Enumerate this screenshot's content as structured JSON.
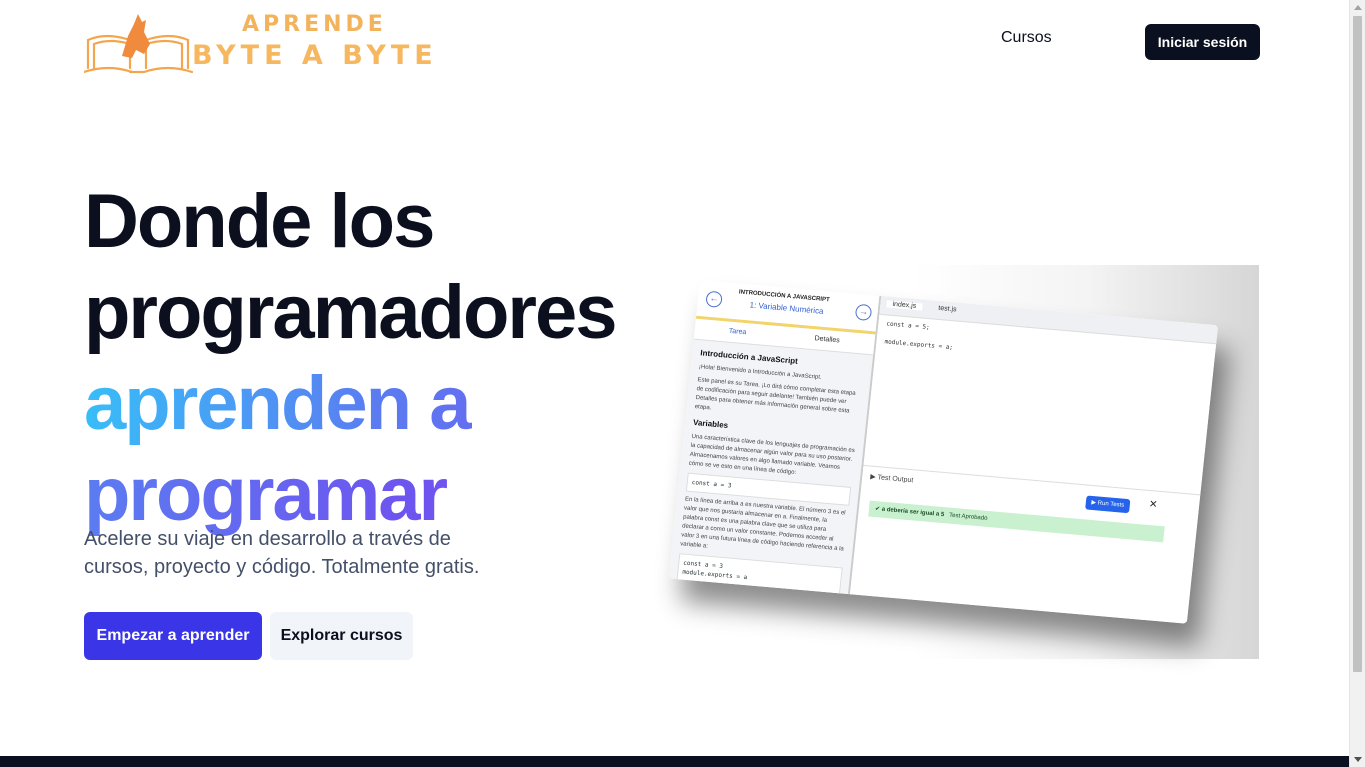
{
  "header": {
    "logo_line1": "APRENDE",
    "logo_line2": "BYTE A BYTE",
    "nav_courses": "Cursos",
    "login_button": "Iniciar sesión"
  },
  "hero": {
    "title_line1": "Donde los",
    "title_line2": "programadores",
    "title_line3": "aprenden a",
    "title_line4": "programar",
    "subtitle": "Acelere su viaje en desarrollo a través de cursos, proyecto y código. Totalmente gratis.",
    "primary_button": "Empezar a aprender",
    "secondary_button": "Explorar cursos"
  },
  "illustration": {
    "course_label": "INTRODUCCIÓN A JAVASCRIPT",
    "lesson_title": "1: Variable Numérica",
    "tab_task": "Tarea",
    "tab_details": "Detalles",
    "section_title": "Introducción a JavaScript",
    "intro_text": "¡Hola! Bienvenido a Introducción a JavaScript.",
    "panel_text": "Este panel es su Tarea. ¡Lo dirá cómo completar esta etapa de codificación para seguir adelante! También puede ver Detalles para obtener más información general sobre esta etapa.",
    "variables_title": "Variables",
    "variables_text": "Una característica clave de los lenguajes de programación es la capacidad de almacenar algún valor para su uso posterior. Almacenamos valores en algo llamado variable. Veamos cómo se ve esto en una línea de código:",
    "code_snippet": "const a = 3",
    "explain_text": "En la línea de arriba a es nuestra variable. El número 3 es el valor que nos gustaría almacenar en a. Finalmente, la palabra const es una palabra clave que se utiliza para declarar a como un valor constante. Podemos acceder al valor 3 en una futura línea de código haciendo referencia a la variable a:",
    "code_snippet2_line1": "const a = 3",
    "code_snippet2_line3": "module.exports = a",
    "file_tab1": "index.js",
    "file_tab2": "test.js",
    "editor_line1": "const a = 5;",
    "editor_line3": "module.exports = a;",
    "test_output_label": "Test Output",
    "run_tests_button": "Run Tests",
    "test_name": "a debería ser igual a 5",
    "test_result": "Test Aprobado"
  },
  "colors": {
    "primary": "#3b35e8",
    "dark": "#0b1020",
    "gradient_start": "#38bdf8",
    "gradient_end": "#7c4ff0",
    "logo": "#f3b35c"
  }
}
